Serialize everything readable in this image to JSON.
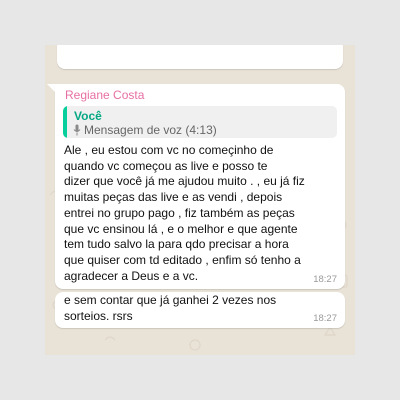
{
  "message": {
    "sender": "Regiane Costa",
    "quote": {
      "author": "Você",
      "icon": "mic-icon",
      "text": "Mensagem de voz (4:13)"
    },
    "lines": [
      "Ale  , eu estou com vc  no começinho de",
      "quando vc começou as live   e posso te",
      "dizer  que você  já me ajudou muito . , eu já fiz",
      "muitas peças  das live  e as vendi  , depois",
      "entrei no grupo pago  , fiz também  as peças",
      "que vc ensinou lá   , e o melhor e que agente",
      "tem tudo salvo la para qdo precisar a hora",
      "que quiser com td editado  , enfim só tenho a",
      "agradecer a Deus e a vc."
    ],
    "time": "18:27"
  },
  "message2": {
    "lines": [
      "e sem contar que já ganhei 2 vezes nos",
      "sorteios. rsrs"
    ],
    "time": "18:27"
  },
  "colors": {
    "sender": "#e76fa3",
    "quote_accent": "#06cf9c",
    "background": "#e9e2d7"
  }
}
